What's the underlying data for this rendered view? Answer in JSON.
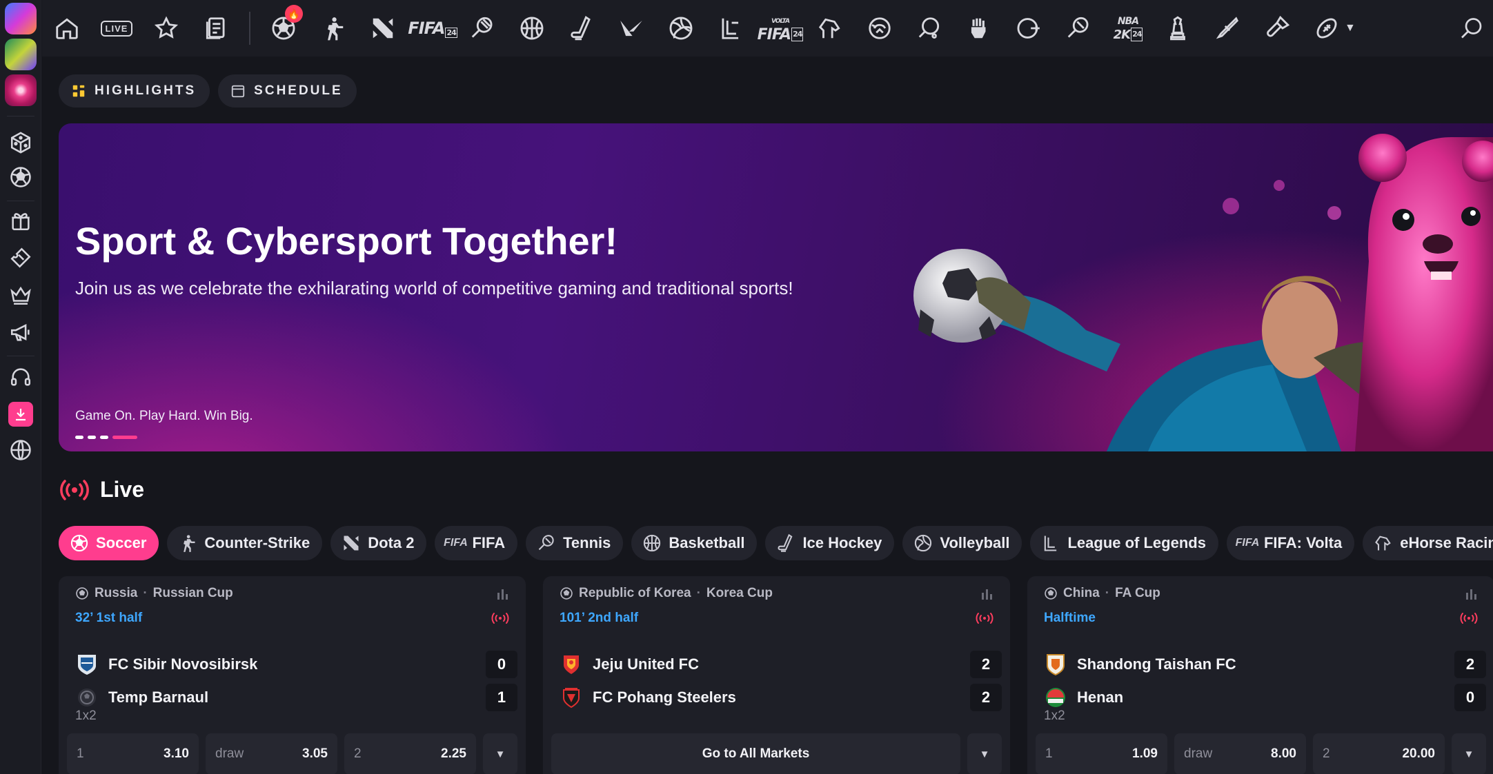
{
  "topnav": {
    "live_label": "LIVE",
    "hot_badge": "🔥",
    "icons": [
      "home-icon",
      "live-icon",
      "star-icon",
      "betslip-icon",
      "soccer-icon",
      "counter-strike-icon",
      "dota2-icon",
      "fifa-icon",
      "tennis-icon",
      "basketball-icon",
      "ice-hockey-icon",
      "valorant-icon",
      "volleyball-icon",
      "league-of-legends-icon",
      "fifa-volta-icon",
      "ehorse-racing-icon",
      "rocket-league-icon",
      "table-tennis-icon",
      "mortal-kombat-icon",
      "ebasketball-icon",
      "etennis-icon",
      "nba2k-icon",
      "chess-icon",
      "hockey-stick-icon",
      "badminton-icon",
      "rugby-icon"
    ],
    "fifa_text": "FIFA",
    "fifa_sub": "24",
    "volta_text": "VOLTA",
    "nba_text": "NBA",
    "nba_sub": "2K"
  },
  "tabs": {
    "highlights": "HIGHLIGHTS",
    "schedule": "SCHEDULE"
  },
  "hero": {
    "title": "Sport & Cybersport Together!",
    "subtitle": "Join us as we celebrate the exhilarating world of competitive gaming and traditional sports!",
    "tagline": "Game On. Play Hard. Win Big.",
    "slide_active": 4,
    "slide_count": 4
  },
  "live": {
    "title": "Live"
  },
  "chips": [
    {
      "label": "Soccer",
      "icon": "soccer-icon",
      "active": true
    },
    {
      "label": "Counter-Strike",
      "icon": "counter-strike-icon",
      "active": false
    },
    {
      "label": "Dota 2",
      "icon": "dota2-icon",
      "active": false
    },
    {
      "label": "FIFA",
      "icon": "fifa-icon",
      "active": false
    },
    {
      "label": "Tennis",
      "icon": "tennis-icon",
      "active": false
    },
    {
      "label": "Basketball",
      "icon": "basketball-icon",
      "active": false
    },
    {
      "label": "Ice Hockey",
      "icon": "ice-hockey-icon",
      "active": false
    },
    {
      "label": "Volleyball",
      "icon": "volleyball-icon",
      "active": false
    },
    {
      "label": "League of Legends",
      "icon": "league-of-legends-icon",
      "active": false
    },
    {
      "label": "FIFA: Volta",
      "icon": "fifa-volta-icon",
      "active": false
    },
    {
      "label": "eHorse Racing",
      "icon": "ehorse-racing-icon",
      "active": false
    }
  ],
  "matches": [
    {
      "country": "Russia",
      "league": "Russian Cup",
      "time": "32’ 1st half",
      "home": {
        "name": "FC Sibir Novosibirsk",
        "score": "0"
      },
      "away": {
        "name": "Temp Barnaul",
        "score": "1"
      },
      "market": "1x2",
      "odds": [
        {
          "label": "1",
          "value": "3.10"
        },
        {
          "label": "draw",
          "value": "3.05"
        },
        {
          "label": "2",
          "value": "2.25"
        }
      ]
    },
    {
      "country": "Republic of Korea",
      "league": "Korea Cup",
      "time": "101’ 2nd half",
      "home": {
        "name": "Jeju United FC",
        "score": "2"
      },
      "away": {
        "name": "FC Pohang Steelers",
        "score": "2"
      },
      "goto_label": "Go to All Markets"
    },
    {
      "country": "China",
      "league": "FA Cup",
      "time": "Halftime",
      "home": {
        "name": "Shandong Taishan FC",
        "score": "2"
      },
      "away": {
        "name": "Henan",
        "score": "0"
      },
      "market": "1x2",
      "odds": [
        {
          "label": "1",
          "value": "1.09"
        },
        {
          "label": "draw",
          "value": "8.00"
        },
        {
          "label": "2",
          "value": "20.00"
        }
      ]
    }
  ],
  "colors": {
    "accent": "#ff3d8e",
    "time": "#3ea7ff",
    "background": "#15161c"
  }
}
